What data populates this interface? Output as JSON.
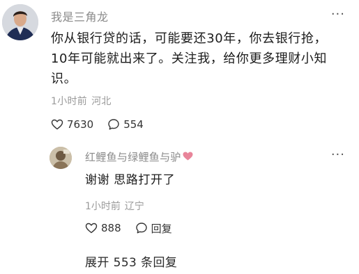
{
  "main_comment": {
    "author": "我是三角龙",
    "text": "你从银行贷的话，可能要还30年，你去银行抢，10年可能就出来了。关注我，给你更多理财小知识。",
    "time": "1小时前",
    "location": "河北",
    "likes": "7630",
    "comments": "554",
    "more_icon": "more-horizontal-icon"
  },
  "reply": {
    "author": "红鲤鱼与绿鲤鱼与驴",
    "text": "谢谢 思路打开了",
    "time": "1小时前",
    "location": "辽宁",
    "likes": "888",
    "reply_label": "回复",
    "more_icon": "more-horizontal-icon"
  },
  "expand": {
    "label": "展开 553 条回复"
  },
  "colors": {
    "meta_gray": "#9a9a9a",
    "text_dark": "#1c1c1c",
    "heart_pink": "#e8859a"
  }
}
